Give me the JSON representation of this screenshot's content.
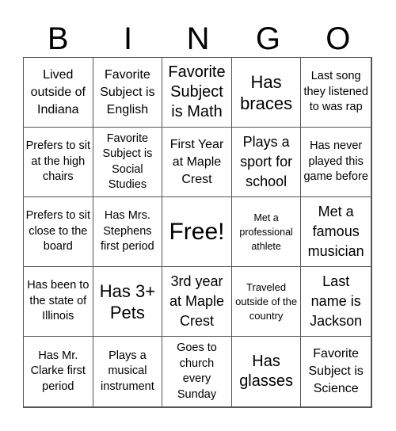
{
  "header": {
    "letters": [
      "B",
      "I",
      "N",
      "G",
      "O"
    ]
  },
  "cells": [
    [
      "Lived outside of Indiana",
      "Favorite Subject is English",
      "Favorite Subject is Math",
      "Has braces",
      "Last song they listened to was rap"
    ],
    [
      "Prefers to sit at the high chairs",
      "Favorite Subject is Social Studies",
      "First Year at Maple Crest",
      "Plays a sport for school",
      "Has never played this game before"
    ],
    [
      "Prefers to sit close to the board",
      "Has Mrs. Stephens first period",
      "Free!",
      "Met a professional athlete",
      "Met a famous musician"
    ],
    [
      "Has been to the state of Illinois",
      "Has 3+ Pets",
      "3rd year at Maple Crest",
      "Traveled outside of the country",
      "Last name is Jackson"
    ],
    [
      "Has Mr. Clarke first period",
      "Plays a musical instrument",
      "Goes to church every Sunday",
      "Has glasses",
      "Favorite Subject is Science"
    ]
  ]
}
